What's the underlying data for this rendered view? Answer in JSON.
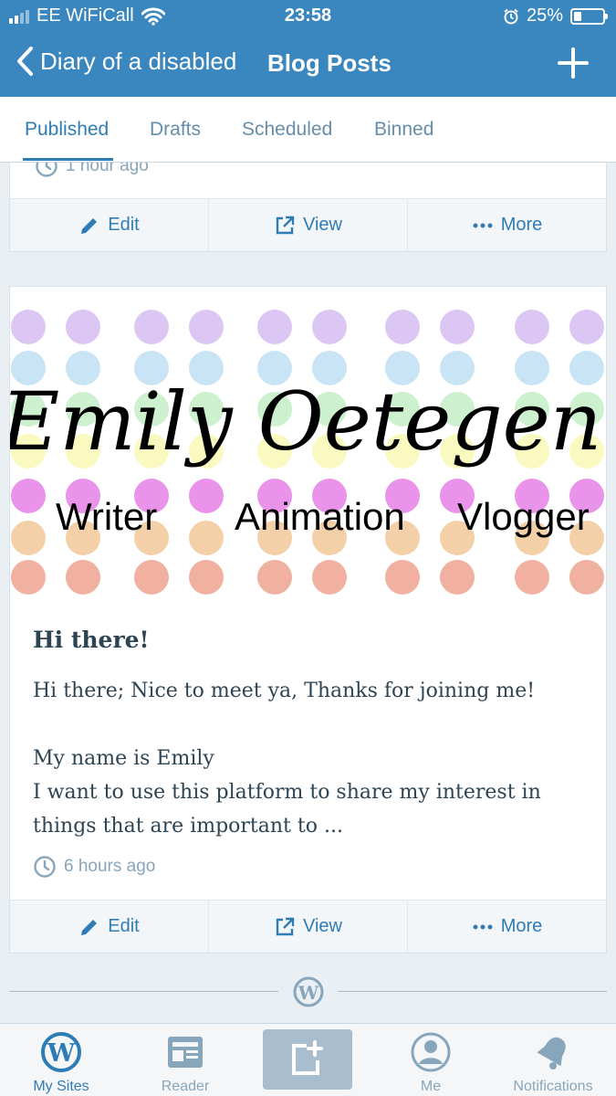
{
  "status_bar": {
    "carrier": "EE WiFiCall",
    "time": "23:58",
    "battery": "25%",
    "battery_level": 0.25
  },
  "nav": {
    "back_label": "Diary of a disabled",
    "title": "Blog Posts"
  },
  "tabs": [
    {
      "label": "Published",
      "active": true
    },
    {
      "label": "Drafts",
      "active": false
    },
    {
      "label": "Scheduled",
      "active": false
    },
    {
      "label": "Binned",
      "active": false
    }
  ],
  "posts": [
    {
      "time": "1 hour ago",
      "actions": {
        "edit": "Edit",
        "view": "View",
        "more": "More"
      }
    },
    {
      "banner": {
        "name": "Emily Oetegen",
        "tags": [
          "Writer",
          "Animation",
          "Vlogger"
        ]
      },
      "title": "Hi there!",
      "excerpt": [
        "Hi there; Nice to meet ya, Thanks for joining me!",
        "My name is Emily",
        "I want to use this platform to share my interest in things that are important to ..."
      ],
      "time": "6 hours ago",
      "actions": {
        "edit": "Edit",
        "view": "View",
        "more": "More"
      }
    }
  ],
  "tabbar": [
    {
      "label": "My Sites",
      "icon": "wordpress-icon",
      "active": true
    },
    {
      "label": "Reader",
      "icon": "reader-icon",
      "active": false
    },
    {
      "label": "",
      "icon": "write-icon",
      "active": false
    },
    {
      "label": "Me",
      "icon": "me-icon",
      "active": false
    },
    {
      "label": "Notifications",
      "icon": "bell-icon",
      "active": false
    }
  ],
  "colors": {
    "nav": "#3a87c0",
    "accent": "#2e7cb5",
    "muted": "#87a6bc",
    "text": "#2e4453"
  }
}
